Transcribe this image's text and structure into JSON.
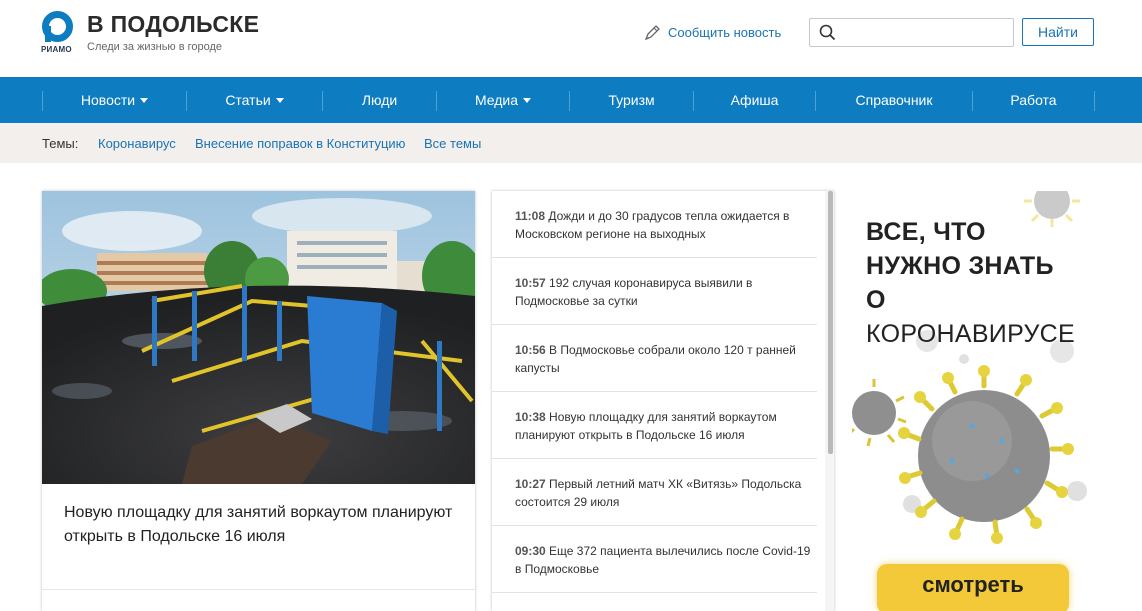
{
  "header": {
    "logo_caption": "РИАМО",
    "site_title": "В ПОДОЛЬСКЕ",
    "tagline": "Следи за жизнью в городе",
    "report_news": "Сообщить новость",
    "search_placeholder": "",
    "search_button": "Найти"
  },
  "nav": {
    "items": [
      {
        "label": "Новости",
        "has_dropdown": true
      },
      {
        "label": "Статьи",
        "has_dropdown": true
      },
      {
        "label": "Люди",
        "has_dropdown": false
      },
      {
        "label": "Медиа",
        "has_dropdown": true
      },
      {
        "label": "Туризм",
        "has_dropdown": false
      },
      {
        "label": "Афиша",
        "has_dropdown": false
      },
      {
        "label": "Справочник",
        "has_dropdown": false
      },
      {
        "label": "Работа",
        "has_dropdown": false
      }
    ]
  },
  "topics": {
    "label": "Темы:",
    "links": [
      "Коронавирус",
      "Внесение поправок в Конституцию",
      "Все темы"
    ]
  },
  "main_story": {
    "title": "Новую площадку для занятий воркаутом планируют открыть в Подольске 16 июля"
  },
  "feed": [
    {
      "time": "11:08",
      "text": "Дожди и до 30 градусов тепла ожидается в Московском регионе на выходных"
    },
    {
      "time": "10:57",
      "text": "192 случая коронавируса выявили в Подмосковье за сутки"
    },
    {
      "time": "10:56",
      "text": "В Подмосковье собрали около 120 т ранней капусты"
    },
    {
      "time": "10:38",
      "text": "Новую площадку для занятий воркаутом планируют открыть в Подольске 16 июля"
    },
    {
      "time": "10:27",
      "text": "Первый летний матч ХК «Витязь» Подольска состоится 29 июля"
    },
    {
      "time": "09:30",
      "text": "Еще 372 пациента вылечились после Covid-19 в Подмосковье"
    }
  ],
  "banner": {
    "line1": "ВСЕ, ЧТО",
    "line2": "НУЖНО ЗНАТЬ",
    "line3_bold": "О",
    "line3_light": "КОРОНАВИРУСЕ",
    "button": "смотреть"
  },
  "colors": {
    "brand_blue": "#0d7cc1",
    "link_blue": "#1a73b5",
    "topics_bg": "#f3efed",
    "banner_yellow": "#f3c93a"
  }
}
